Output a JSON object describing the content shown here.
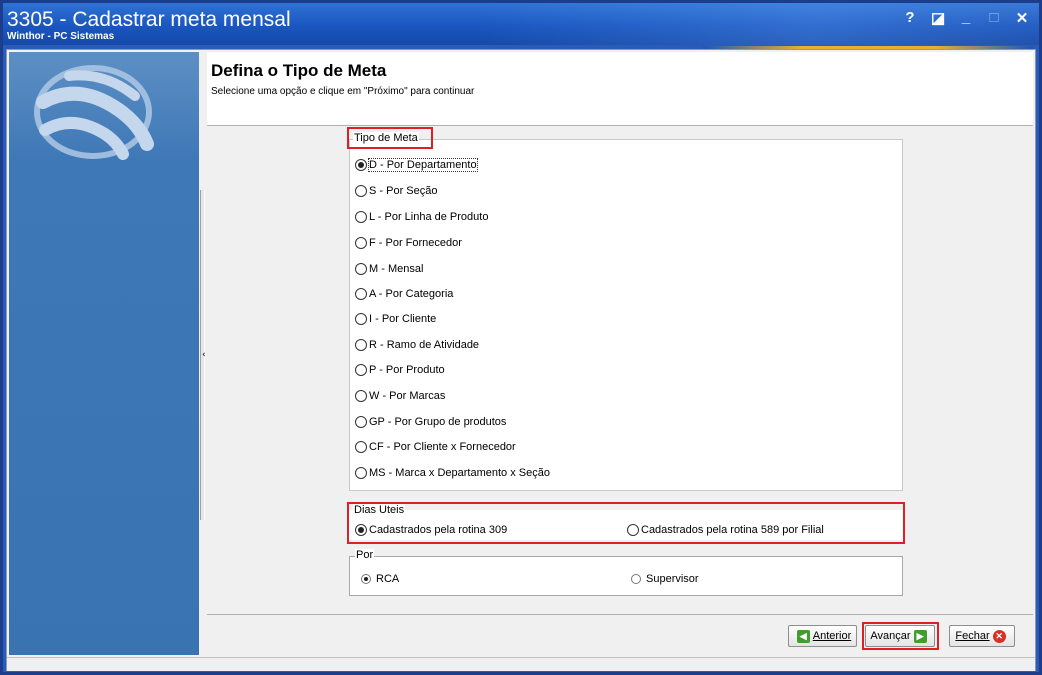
{
  "window": {
    "title": "3305 - Cadastrar meta mensal",
    "subtitle": "Winthor - PC Sistemas",
    "controls": {
      "help": "?",
      "restore": "◪",
      "minimize": "_",
      "maximize": "□",
      "close": "✕"
    }
  },
  "header": {
    "title": "Defina o Tipo de Meta",
    "instruction": "Selecione uma opção e clique em \"Próximo\" para continuar"
  },
  "tipo_meta": {
    "legend": "Tipo de Meta",
    "selected": "D - Por Departamento",
    "options": [
      "D - Por Departamento",
      "S - Por Seção",
      "L - Por Linha de Produto",
      "F - Por Fornecedor",
      "M - Mensal",
      "A - Por Categoria",
      "I - Por Cliente",
      "R - Ramo de Atividade",
      "P - Por Produto",
      "W - Por Marcas",
      "GP - Por Grupo de produtos",
      "CF - Por Cliente x Fornecedor",
      "MS - Marca x Departamento x Seção"
    ]
  },
  "dias_uteis": {
    "legend": "Dias Uteis",
    "options": [
      "Cadastrados pela rotina 309",
      "Cadastrados pela rotina 589 por Filial"
    ],
    "selected": "Cadastrados pela rotina 309"
  },
  "por": {
    "legend": "Por",
    "options": [
      "RCA",
      "Supervisor"
    ],
    "selected": "RCA"
  },
  "buttons": {
    "anterior": "Anterior",
    "avancar": "Avançar",
    "fechar": "Fechar"
  },
  "colors": {
    "title_bar": "#1a56c0",
    "side_panel": "#3a73b2",
    "highlight": "#e01e26",
    "button_icon_green": "#3f9e2c",
    "button_icon_red": "#d93025"
  }
}
